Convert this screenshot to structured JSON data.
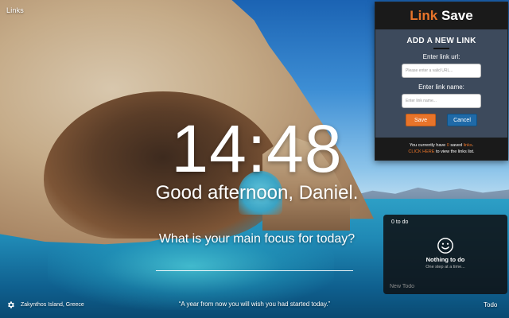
{
  "app": {
    "links_label": "Links"
  },
  "center": {
    "clock": "14:48",
    "greeting": "Good afternoon, Daniel.",
    "focus_question": "What is your main focus for today?"
  },
  "bottom": {
    "location": "Zakynthos Island, Greece",
    "quote": "“A year from now you will wish you had started today.”",
    "todo_label": "Todo",
    "settings_icon": "gear-icon"
  },
  "link_save": {
    "brand_part1": "Link",
    "brand_part2": " Save",
    "title": "ADD A NEW LINK",
    "url_label": "Enter link url:",
    "url_placeholder": "Please enter a valid URL...",
    "name_label": "Enter link name:",
    "name_placeholder": "Enter link name...",
    "save_label": "Save",
    "cancel_label": "Cancel",
    "footer_prefix": "You currently have ",
    "saved_count": "0",
    "footer_mid": " saved ",
    "footer_links_word": "links",
    "footer_end": ".",
    "click_here": "CLICK HERE",
    "footer_line2_rest": " to view the links list.",
    "accent_color": "#e8742a",
    "cancel_color": "#1f6aa8"
  },
  "todo": {
    "count_text": "0 to do",
    "empty_title": "Nothing to do",
    "empty_subtitle": "One step at a time...",
    "new_placeholder": "New Todo",
    "icon": "smiley-icon"
  }
}
